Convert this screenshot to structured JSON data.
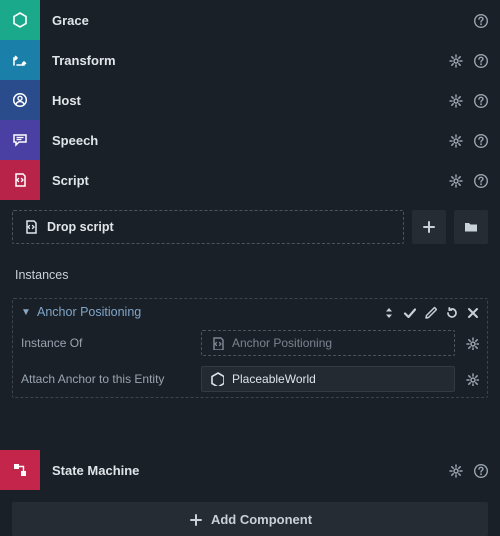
{
  "components": [
    {
      "label": "Grace",
      "color": "c-teal",
      "icon": "hexagon",
      "gear": false,
      "help": true
    },
    {
      "label": "Transform",
      "color": "c-cyan",
      "icon": "transform",
      "gear": true,
      "help": true
    },
    {
      "label": "Host",
      "color": "c-blue",
      "icon": "user",
      "gear": true,
      "help": true
    },
    {
      "label": "Speech",
      "color": "c-purple",
      "icon": "speech",
      "gear": true,
      "help": true
    },
    {
      "label": "Script",
      "color": "c-magenta",
      "icon": "script",
      "gear": true,
      "help": true
    }
  ],
  "dropScript": {
    "placeholder": "Drop script"
  },
  "instancesTitle": "Instances",
  "instance": {
    "title": "Anchor Positioning",
    "fields": [
      {
        "label": "Instance Of",
        "value": "Anchor Positioning",
        "style": "dashed",
        "icon": "script"
      },
      {
        "label": "Attach Anchor to this Entity",
        "value": "PlaceableWorld",
        "style": "solid",
        "icon": "hexagon"
      }
    ]
  },
  "stateMachine": {
    "label": "State Machine"
  },
  "addComponent": {
    "label": "Add Component"
  }
}
